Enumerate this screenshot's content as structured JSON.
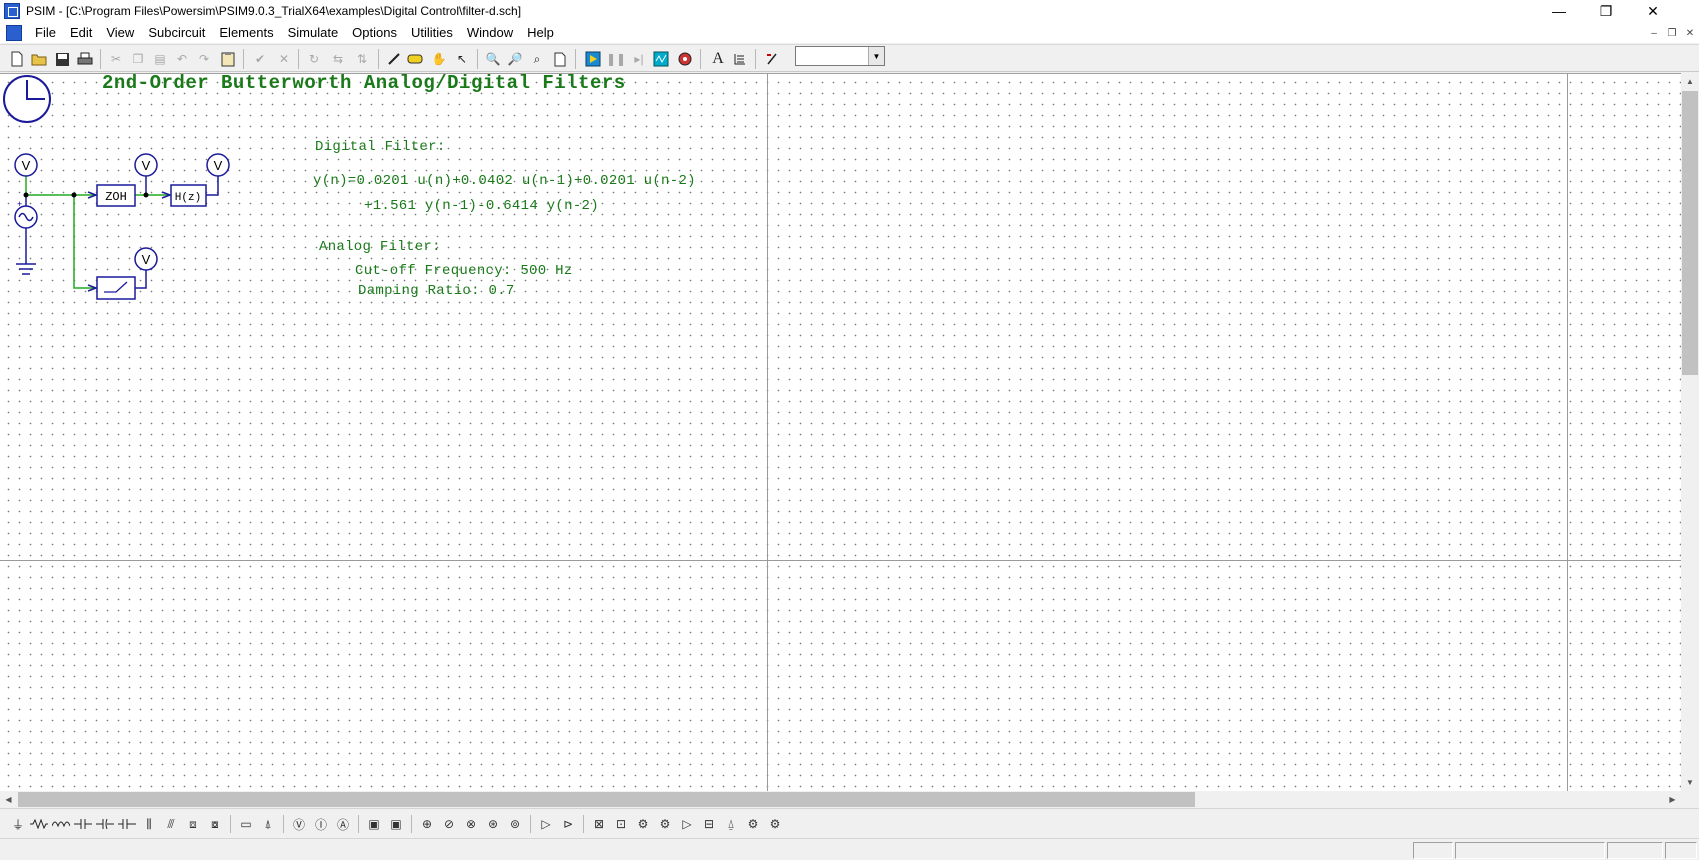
{
  "window": {
    "title": "PSIM - [C:\\Program Files\\Powersim\\PSIM9.0.3_TrialX64\\examples\\Digital Control\\filter-d.sch]",
    "minimize_glyph": "—",
    "maximize_glyph": "❐",
    "close_glyph": "✕"
  },
  "menu": {
    "items": [
      "File",
      "Edit",
      "View",
      "Subcircuit",
      "Elements",
      "Simulate",
      "Options",
      "Utilities",
      "Window",
      "Help"
    ]
  },
  "toolbar": {
    "combo_value": "",
    "text_tool_glyph": "A"
  },
  "schematic": {
    "heading": "2nd-Order Butterworth Analog/Digital Filters",
    "digital_label": "Digital Filter:",
    "digital_eq_line1": "y(n)=0.0201 u(n)+0.0402 u(n-1)+0.0201 u(n-2)",
    "digital_eq_line2": "+1.561 y(n-1)-0.6414 y(n-2)",
    "analog_label": "Analog Filter:",
    "analog_cutoff": "Cut-off Frequency: 500 Hz",
    "analog_damping": "Damping Ratio: 0.7",
    "zoh_label": "ZOH",
    "hz_label": "H(z)",
    "voltmeter_label": "V",
    "wire_color": "#22aa22",
    "block_color": "#1a1a9a"
  },
  "colors": {
    "text_green": "#1a7a1a"
  }
}
